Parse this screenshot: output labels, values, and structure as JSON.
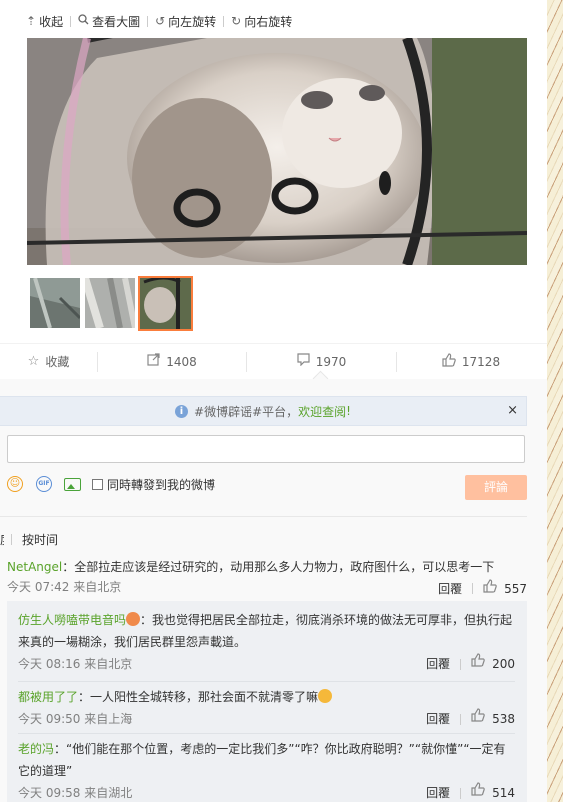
{
  "image_toolbar": {
    "collapse": "收起",
    "view_large": "查看大圖",
    "rotate_left": "向左旋转",
    "rotate_right": "向右旋转"
  },
  "actions": {
    "favorite": "收藏",
    "repost_count": "1408",
    "comment_count": "1970",
    "like_count": "17128"
  },
  "notice": {
    "prefix": "#微博辟谣#平台，",
    "link": "欢迎查阅",
    "suffix": "!",
    "close": "×"
  },
  "composer": {
    "input_value": "",
    "repost_label": "同時轉發到我的微博",
    "submit_label": "評論"
  },
  "sort": {
    "by_hot": "度",
    "by_time": "按时间"
  },
  "comments": [
    {
      "user": "NetAngel",
      "text": "：全部拉走应该是经过研究的，动用那么多人力物力，政府图什么，可以思考一下",
      "time": "今天 07:42 来自北京",
      "reply": "回覆",
      "likes": "557"
    }
  ],
  "sub_comments": [
    {
      "user": "仿生人嘮嗑带电音吗",
      "text": "：我也觉得把居民全部拉走，彻底消杀环境的做法无可厚非，但执行起来真的一場糊涂，我们居民群里怨声載道。",
      "time": "今天 08:16 来自北京",
      "reply": "回覆",
      "likes": "200"
    },
    {
      "user": "都被用了了",
      "text": "：一人阳性全城转移，那社会面不就清零了嘛",
      "time": "今天 09:50 来自上海",
      "reply": "回覆",
      "likes": "538"
    },
    {
      "user": "老的冯",
      "text": "：“他们能在那个位置，考虑的一定比我们多”“咋？你比政府聪明？”“就你懂”“一定有它的道理”",
      "time": "今天 09:58 来自湖北",
      "reply": "回覆",
      "likes": "514"
    }
  ],
  "colors": {
    "link_green": "#5aa32b",
    "submit_disabled": "#ffc09f",
    "selected_thumb": "#fa7d3c"
  }
}
